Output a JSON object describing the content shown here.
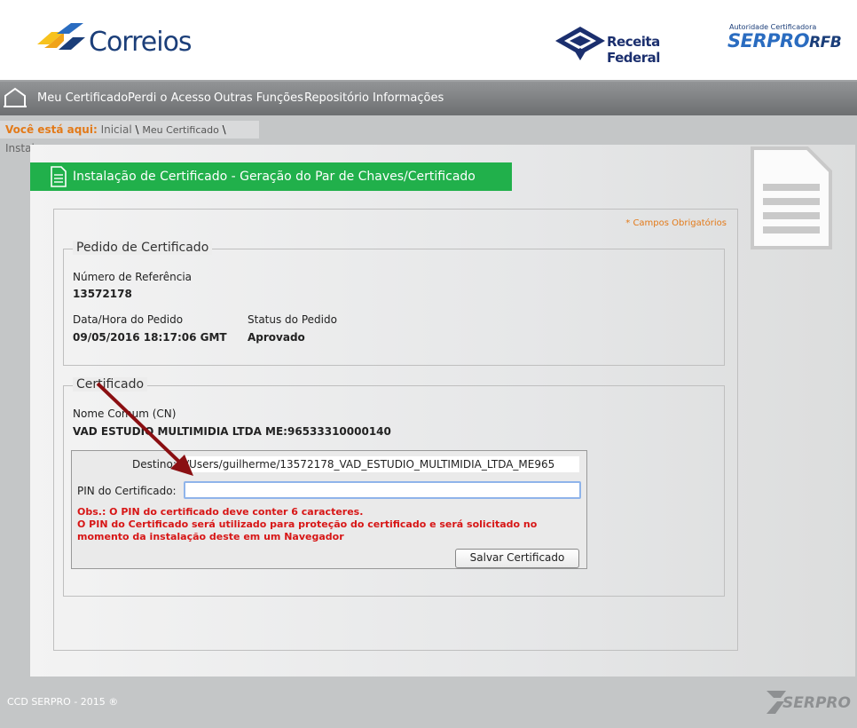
{
  "header": {
    "correios": "Correios",
    "receita": "Receita Federal",
    "serpro_small": "Autoridade Certificadora",
    "serpro_main": "SERPRO",
    "serpro_suffix": "RFB"
  },
  "nav": {
    "items": [
      "Meu Certificado",
      "Perdi o Acesso",
      "Outras Funções",
      "Repositório",
      "Informações"
    ]
  },
  "breadcrumb": {
    "label": "Você está aqui:",
    "home": "Inicial",
    "sep1": " \\ ",
    "current": "Meu Certificado",
    "sep2": " \\ ",
    "last": "Instalar"
  },
  "page": {
    "title": "Instalação de Certificado - Geração do Par de Chaves/Certificado",
    "required_note": "* Campos Obrigatórios"
  },
  "pedido": {
    "legend": "Pedido de Certificado",
    "ref_label": "Número de Referência",
    "ref_value": "13572178",
    "date_label": "Data/Hora do Pedido",
    "date_value": "09/05/2016 18:17:06 GMT",
    "status_label": "Status do Pedido",
    "status_value": "Aprovado"
  },
  "certificado": {
    "legend": "Certificado",
    "cn_label": "Nome Comum (CN)",
    "cn_value": "VAD ESTUDIO MULTIMIDIA LTDA ME:96533310000140",
    "dest_label": "Destino:",
    "dest_value": "/Users/guilherme/13572178_VAD_ESTUDIO_MULTIMIDIA_LTDA_ME965",
    "pin_label": "PIN do Certificado:",
    "pin_value": "",
    "obs_line1": "Obs.: O PIN do certificado deve conter 6 caracteres.",
    "obs_line2": "O PIN do Certificado será utilizado para proteção do certificado e será solicitado no momento da instalação deste em um Navegador",
    "save_button": "Salvar Certificado"
  },
  "footer": {
    "text": "CCD SERPRO - 2015 ®",
    "logo": "SERPRO"
  },
  "colors": {
    "green": "#21b04b",
    "orange": "#e37a19",
    "red": "#d71616",
    "navy": "#1b3e79"
  }
}
